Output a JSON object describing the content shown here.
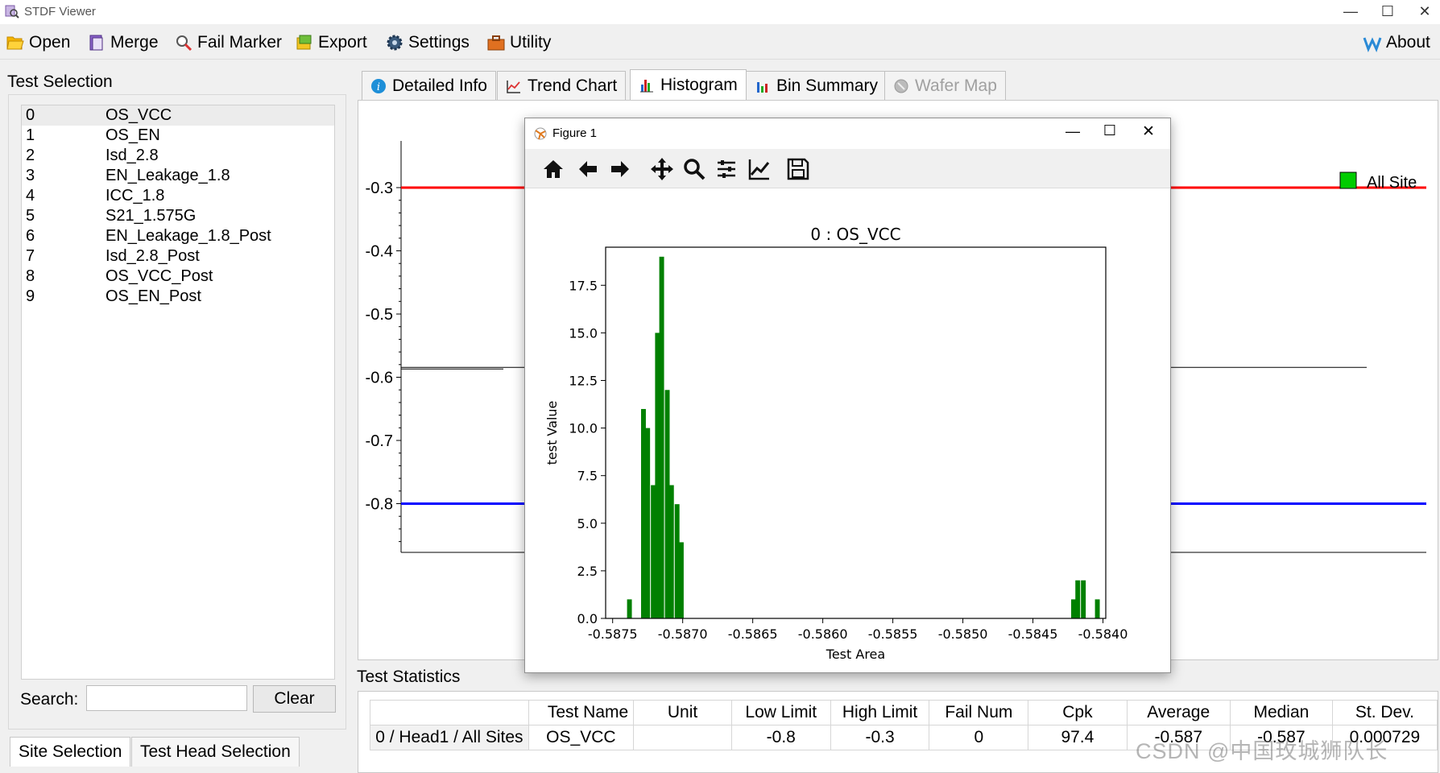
{
  "window": {
    "title": "STDF Viewer"
  },
  "menu": [
    {
      "label": "Open",
      "icon": "folder-open-icon"
    },
    {
      "label": "Merge",
      "icon": "merge-icon"
    },
    {
      "label": "Fail Marker",
      "icon": "fail-marker-icon"
    },
    {
      "label": "Export",
      "icon": "export-icon"
    },
    {
      "label": "Settings",
      "icon": "gear-icon"
    },
    {
      "label": "Utility",
      "icon": "toolbox-icon"
    },
    {
      "label": "About",
      "icon": "about-icon"
    }
  ],
  "left_panel": {
    "title": "Test Selection",
    "tests": [
      {
        "num": "0",
        "name": "OS_VCC"
      },
      {
        "num": "1",
        "name": "OS_EN"
      },
      {
        "num": "2",
        "name": "Isd_2.8"
      },
      {
        "num": "3",
        "name": "EN_Leakage_1.8"
      },
      {
        "num": "4",
        "name": "ICC_1.8"
      },
      {
        "num": "5",
        "name": "S21_1.575G"
      },
      {
        "num": "6",
        "name": "EN_Leakage_1.8_Post"
      },
      {
        "num": "7",
        "name": "Isd_2.8_Post"
      },
      {
        "num": "8",
        "name": "OS_VCC_Post"
      },
      {
        "num": "9",
        "name": "OS_EN_Post"
      }
    ],
    "search_label": "Search:",
    "search_value": "",
    "clear_label": "Clear",
    "bottom_tabs": [
      "Site Selection",
      "Test Head Selection"
    ]
  },
  "tabs": [
    {
      "label": "Detailed Info",
      "state": "normal"
    },
    {
      "label": "Trend Chart",
      "state": "normal"
    },
    {
      "label": "Histogram",
      "state": "active"
    },
    {
      "label": "Bin Summary",
      "state": "normal"
    },
    {
      "label": "Wafer Map",
      "state": "disabled"
    }
  ],
  "main_chart": {
    "y_ticks": [
      "-0.3",
      "-0.4",
      "-0.5",
      "-0.6",
      "-0.7",
      "-0.8"
    ],
    "high_limit": -0.3,
    "low_limit": -0.8,
    "high_limit_color": "#ff0000",
    "low_limit_color": "#0000ff",
    "legend": {
      "label": "All Site",
      "color": "#00cc00"
    }
  },
  "statistics": {
    "title": "Test Statistics",
    "columns": [
      "Test Name",
      "Unit",
      "Low Limit",
      "High Limit",
      "Fail Num",
      "Cpk",
      "Average",
      "Median",
      "St. Dev."
    ],
    "rows": [
      {
        "header": "0 / Head1 / All Sites",
        "cells": [
          "OS_VCC",
          "",
          "-0.8",
          "-0.3",
          "0",
          "97.4",
          "-0.587",
          "-0.587",
          "0.000729"
        ]
      }
    ]
  },
  "figure": {
    "window_title": "Figure 1",
    "toolbar": [
      "home-icon",
      "back-icon",
      "forward-icon",
      "pan-icon",
      "zoom-icon",
      "configure-subplots-icon",
      "edit-axis-icon",
      "save-icon"
    ]
  },
  "chart_data": {
    "type": "bar",
    "title": "0 : OS_VCC",
    "xlabel": "Test Area",
    "ylabel": "test Value",
    "xlim": [
      -0.58755,
      -0.58398
    ],
    "ylim": [
      0,
      19.5
    ],
    "x_ticks": [
      "-0.5875",
      "-0.5870",
      "-0.5865",
      "-0.5860",
      "-0.5855",
      "-0.5850",
      "-0.5845",
      "-0.5840"
    ],
    "y_ticks": [
      "0.0",
      "2.5",
      "5.0",
      "7.5",
      "10.0",
      "12.5",
      "15.0",
      "17.5"
    ],
    "bin_width": 3.415e-05,
    "bins": [
      {
        "x": -0.58738,
        "y": 1
      },
      {
        "x": -0.58728,
        "y": 11
      },
      {
        "x": -0.58725,
        "y": 10
      },
      {
        "x": -0.58721,
        "y": 7
      },
      {
        "x": -0.58718,
        "y": 15
      },
      {
        "x": -0.58715,
        "y": 19
      },
      {
        "x": -0.58711,
        "y": 12
      },
      {
        "x": -0.58708,
        "y": 7
      },
      {
        "x": -0.58704,
        "y": 6
      },
      {
        "x": -0.58701,
        "y": 4
      },
      {
        "x": -0.58421,
        "y": 1
      },
      {
        "x": -0.58418,
        "y": 2
      },
      {
        "x": -0.58414,
        "y": 2
      },
      {
        "x": -0.58404,
        "y": 1
      }
    ],
    "bar_color": "#008000"
  },
  "watermark": "CSDN @中国玫城狮队长"
}
